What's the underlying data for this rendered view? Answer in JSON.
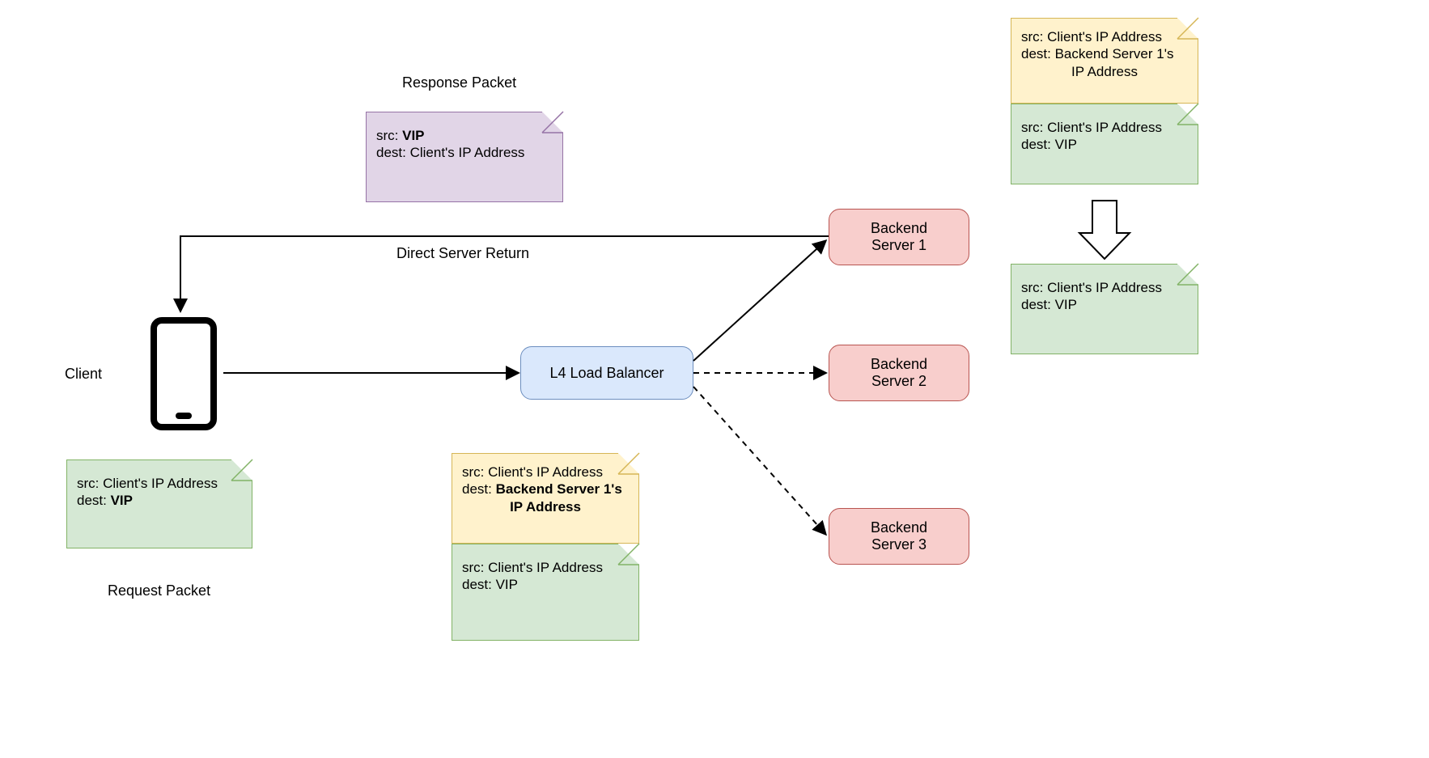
{
  "labels": {
    "response_packet_title": "Response Packet",
    "direct_server_return": "Direct Server Return",
    "client": "Client",
    "l4": "L4 Load Balancer",
    "backend1": "Backend\nServer 1",
    "backend2": "Backend\nServer 2",
    "backend3": "Backend\nServer 3",
    "request_packet_title": "Request Packet"
  },
  "notes": {
    "response": {
      "line1a": "src: ",
      "line1b": "VIP",
      "line2": "dest: Client's IP Address"
    },
    "request": {
      "line1": "src: Client's IP Address",
      "line2a": "dest: ",
      "line2b": "VIP"
    },
    "lb_outer": {
      "line1": "src: Client's IP Address",
      "line2a": "dest: ",
      "line2b": "Backend Server 1's",
      "line2c": "IP Address"
    },
    "lb_inner": {
      "line1": "src: Client's IP Address",
      "line2": "dest: VIP"
    },
    "srv_outer": {
      "line1": "src: Client's IP Address",
      "line2": "dest: Backend Server 1's",
      "line3": "IP Address"
    },
    "srv_inner": {
      "line1": "src: Client's IP Address",
      "line2": "dest: VIP"
    },
    "result": {
      "line1": "src: Client's IP Address",
      "line2": "dest: VIP"
    }
  }
}
